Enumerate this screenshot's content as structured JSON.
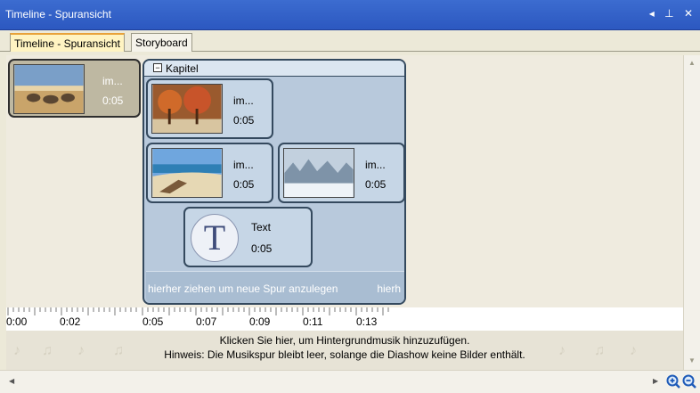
{
  "window": {
    "title": "Timeline - Spuransicht"
  },
  "tabs": [
    {
      "label": "Timeline - Spuransicht",
      "active": true
    },
    {
      "label": "Storyboard",
      "active": false
    }
  ],
  "clips": {
    "outer": {
      "name": "im...",
      "duration": "0:05"
    },
    "chapter": {
      "label": "Kapitel",
      "collapse_symbol": "−",
      "items": [
        {
          "name": "im...",
          "duration": "0:05"
        },
        {
          "name": "im...",
          "duration": "0:05"
        },
        {
          "name": "im...",
          "duration": "0:05"
        }
      ],
      "text_clip": {
        "icon_letter": "T",
        "name": "Text",
        "duration": "0:05"
      },
      "drop_hint": "hierher ziehen um neue Spur anzulegen",
      "drop_hint_right": "hierh"
    }
  },
  "ruler": {
    "labels": [
      "0:00",
      "0:02",
      "0:05",
      "0:07",
      "0:09",
      "0:11",
      "0:13"
    ]
  },
  "music": {
    "line1": "Klicken Sie hier, um Hintergrundmusik hinzuzufügen.",
    "line2": "Hinweis: Die Musikspur bleibt leer, solange die Diashow keine Bilder enthält."
  },
  "icons": {
    "zoom_in": "zoom-in-icon",
    "zoom_out": "zoom-out-icon"
  }
}
